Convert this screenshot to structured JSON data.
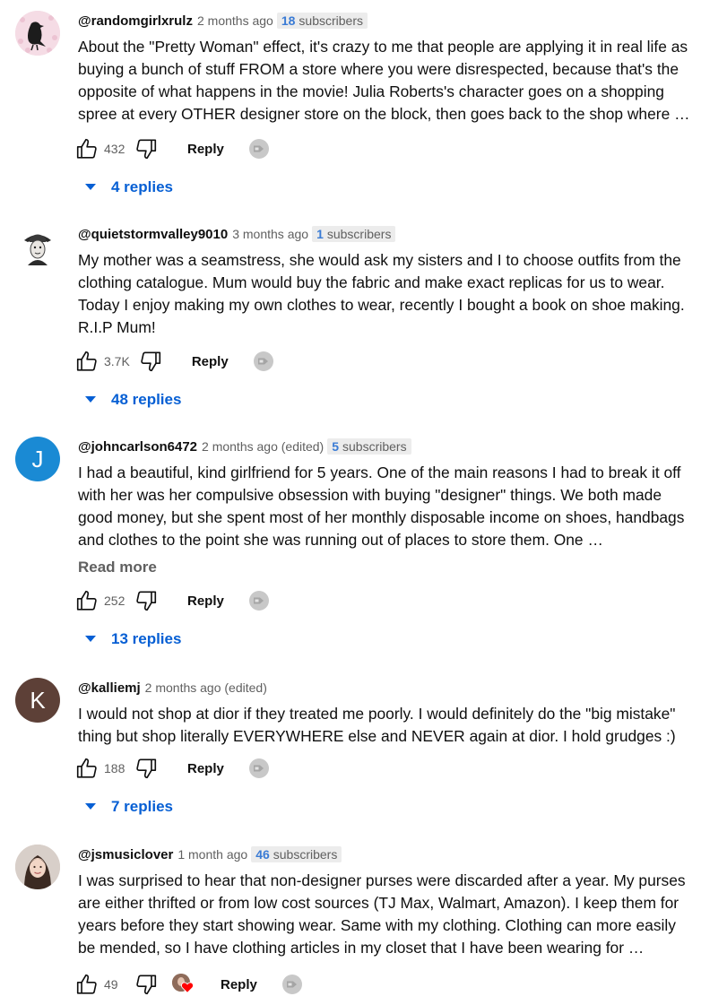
{
  "comments": [
    {
      "handle": "@randomgirlxrulz",
      "time": "2 months ago",
      "subs_count": "18",
      "subs_label": "subscribers",
      "text": "About the \"Pretty Woman\" effect, it's crazy to me that people are applying it in real life as buying a bunch of stuff FROM a store where you were disrespected, because that's the opposite of what happens in the movie! Julia Roberts's character goes on a shopping spree at every OTHER designer store on the block, then goes back to the shop where …",
      "likes": "432",
      "reply": "Reply",
      "replies": "4 replies"
    },
    {
      "handle": "@quietstormvalley9010",
      "time": "3 months ago",
      "subs_count": "1",
      "subs_label": "subscribers",
      "text": "My mother was a seamstress, she would ask my sisters and I to choose outfits from the clothing catalogue. Mum would buy the fabric and make exact replicas for us to wear. Today I enjoy making my own clothes to wear, recently I bought a book on shoe making. R.I.P Mum!",
      "likes": "3.7K",
      "reply": "Reply",
      "replies": "48 replies"
    },
    {
      "handle": "@johncarlson6472",
      "time": "2 months ago (edited)",
      "subs_count": "5",
      "subs_label": "subscribers",
      "avatar_letter": "J",
      "avatar_color": "#1a8ad4",
      "text": "I had a beautiful, kind girlfriend for 5 years.  One of the main reasons I had to break it off with her was her compulsive obsession with buying \"designer\" things. We both made good money, but she spent most of her monthly disposable income on shoes, handbags and clothes to the point she was running out of places to store them. One …",
      "read_more": "Read more",
      "likes": "252",
      "reply": "Reply",
      "replies": "13 replies"
    },
    {
      "handle": "@kalliemj",
      "time": "2 months ago (edited)",
      "avatar_letter": "K",
      "avatar_color": "#5d4037",
      "text": "I would not shop at dior if they treated me poorly. I would definitely do the \"big mistake\" thing but shop literally EVERYWHERE else and NEVER again at dior. I hold grudges :)",
      "likes": "188",
      "reply": "Reply",
      "replies": "7 replies"
    },
    {
      "handle": "@jsmusiclover",
      "time": "1 month ago",
      "subs_count": "46",
      "subs_label": "subscribers",
      "text": "I was surprised to hear that non-designer purses were discarded after a year. My purses are either thrifted or from low cost sources (TJ Max, Walmart, Amazon). I keep them for years before they start showing wear. Same with my clothing. Clothing can more easily be mended, so I have clothing articles in my closet that I have been wearing for …",
      "likes": "49",
      "reply": "Reply"
    }
  ],
  "icons": {
    "like": "thumb-up-icon",
    "dislike": "thumb-down-icon",
    "badge": "subscriber-badge-icon",
    "expand": "caret-down-icon",
    "hearted": "creator-heart-icon"
  },
  "colors": {
    "link_blue": "#065fd4",
    "subs_blue": "#3a7bd5",
    "meta_grey": "#606060"
  }
}
